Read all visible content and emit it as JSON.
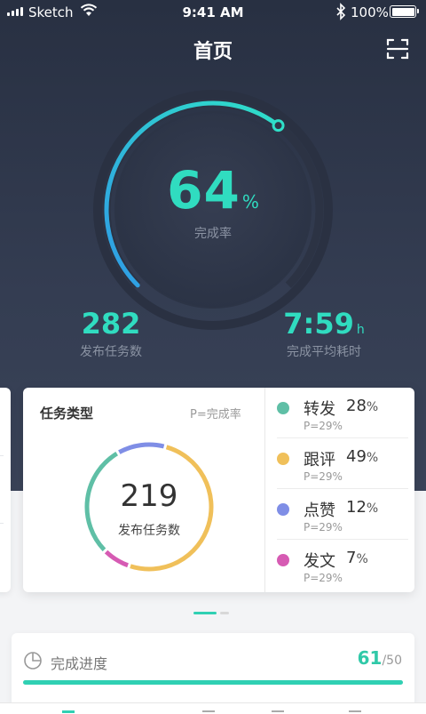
{
  "status_bar": {
    "carrier": "Sketch",
    "time": "9:41 AM",
    "battery": "100%"
  },
  "nav": {
    "title": "首页",
    "scan_icon": "scan-icon"
  },
  "gauge": {
    "percent": "64",
    "unit": "%",
    "label": "完成率",
    "progress": 0.64,
    "accent": "#30dcc0"
  },
  "stats": {
    "tasks_value": "282",
    "tasks_label": "发布任务数",
    "avg_time_value": "7:59",
    "avg_time_unit": "h",
    "avg_time_label": "完成平均耗时"
  },
  "task_card": {
    "title": "任务类型",
    "subtitle": "P=完成率",
    "total": "219",
    "total_label": "发布任务数",
    "items": [
      {
        "name": "转发",
        "value": "28",
        "unit": "%",
        "p": "P=29%",
        "color": "#5fbfa6",
        "share": 0.28
      },
      {
        "name": "跟评",
        "value": "49",
        "unit": "%",
        "p": "P=29%",
        "color": "#f0c05a",
        "share": 0.49
      },
      {
        "name": "点赞",
        "value": "12",
        "unit": "%",
        "p": "P=29%",
        "color": "#7f8ee6",
        "share": 0.12
      },
      {
        "name": "发文",
        "value": "7",
        "unit": "%",
        "p": "P=29%",
        "color": "#d65bb3",
        "share": 0.07
      }
    ]
  },
  "progress": {
    "label": "完成进度",
    "done": "61",
    "total": "/50",
    "fraction": 1.0,
    "icon": "pie-chart-icon"
  }
}
